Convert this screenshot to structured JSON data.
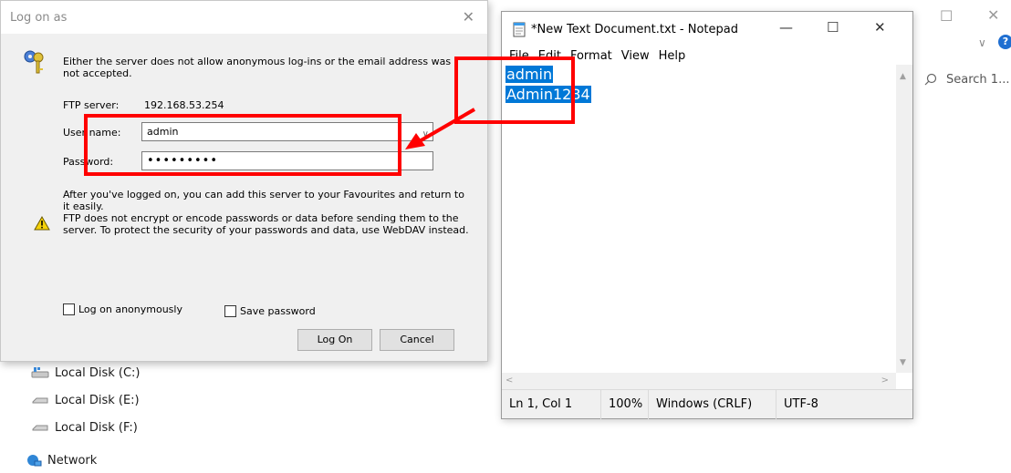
{
  "explorer": {
    "search_placeholder": "Search 1...",
    "nav_items": [
      "Local Disk (C:)",
      "Local Disk (E:)",
      "Local Disk (F:)",
      "Network"
    ]
  },
  "dialog": {
    "title": "Log on as",
    "message": "Either the server does not allow anonymous log-ins or the email address was not accepted.",
    "ftp_server_label": "FTP server:",
    "ftp_server_value": "192.168.53.254",
    "username_label": "User name:",
    "username_value": "admin",
    "password_label": "Password:",
    "password_value": "•••••••••",
    "info_text": "After you've logged on, you can add this server to your Favourites and return to it easily.",
    "warning_text": "FTP does not encrypt or encode passwords or data before sending them to the server. To protect the security of your passwords and data, use WebDAV instead.",
    "anonymous_label": "Log on anonymously",
    "save_password_label": "Save password",
    "logon_button": "Log On",
    "cancel_button": "Cancel"
  },
  "notepad": {
    "title": "*New Text Document.txt - Notepad",
    "menu": [
      "File",
      "Edit",
      "Format",
      "View",
      "Help"
    ],
    "lines": [
      "admin",
      "Admin1234"
    ],
    "status": {
      "position": "Ln 1, Col 1",
      "zoom": "100%",
      "line_ending": "Windows (CRLF)",
      "encoding": "UTF-8"
    }
  },
  "colors": {
    "annotation": "#ff0000",
    "selection": "#0078d7",
    "accent": "#1f6fd1"
  }
}
